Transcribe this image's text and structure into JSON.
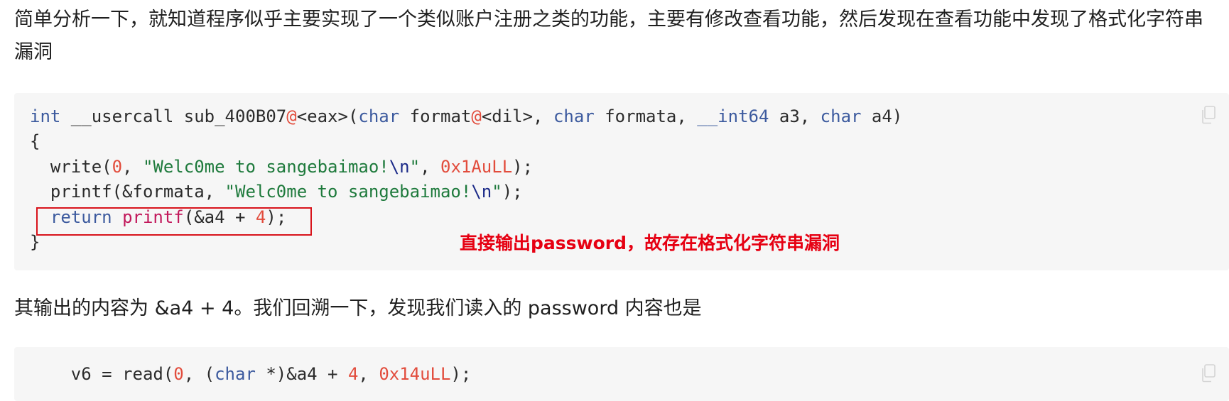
{
  "paragraphs": {
    "intro": "简单分析一下，就知道程序似乎主要实现了一个类似账户注册之类的功能，主要有修改查看功能，然后发现在查看功能中发现了格式化字符串漏洞",
    "output_note": "其输出的内容为 &a4 + 4。我们回溯一下，发现我们读入的 password 内容也是"
  },
  "code_block_1": {
    "line1": {
      "t1": "int",
      "t2": " __usercall sub_400B07",
      "t3": "@",
      "t4": "<eax>(",
      "t5": "char",
      "t6": " format",
      "t7": "@",
      "t8": "<dil>, ",
      "t9": "char",
      "t10": " formata, ",
      "t11": "__int64",
      "t12": " a3, ",
      "t13": "char",
      "t14": " a4)"
    },
    "line2": "{",
    "line3": {
      "t1": "  write(",
      "t2": "0",
      "t3": ", ",
      "t4": "\"Welc0me to sangebaimao!",
      "t5": "\\n",
      "t6": "\"",
      "t7": ", ",
      "t8": "0x1AuLL",
      "t9": ");"
    },
    "line4": {
      "t1": "  printf(&formata, ",
      "t2": "\"Welc0me to sangebaimao!",
      "t3": "\\n",
      "t4": "\"",
      "t5": ");"
    },
    "line5": {
      "t1": "  ",
      "t2": "return",
      "t3": " ",
      "t4": "printf",
      "t5": "(&a4 + ",
      "t6": "4",
      "t7": ");"
    },
    "line6": "}"
  },
  "annotation": "直接输出password，故存在格式化字符串漏洞",
  "code_block_2": {
    "line1": {
      "t1": "    v6 = read(",
      "t2": "0",
      "t3": ", (",
      "t4": "char",
      "t5": " *)&a4 + ",
      "t6": "4",
      "t7": ", ",
      "t8": "0x14uLL",
      "t9": ");"
    }
  },
  "icons": {
    "copy": "copy-icon"
  },
  "colors": {
    "keyword": "#3c5a9e",
    "function": "#c2185b",
    "string": "#1e7a3c",
    "number": "#e24c3c",
    "annotation": "#e60012",
    "highlight_border": "#d8131b",
    "code_background": "#f6f6f6"
  }
}
